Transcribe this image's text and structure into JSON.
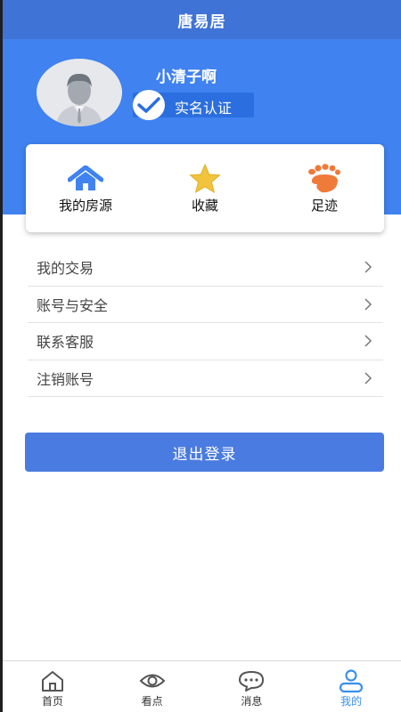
{
  "header": {
    "title": "唐易居"
  },
  "profile": {
    "username": "小清子啊",
    "verify_label": "实名认证"
  },
  "quick_actions": [
    {
      "label": "我的房源",
      "icon": "home-icon",
      "color": "#3f82f0"
    },
    {
      "label": "收藏",
      "icon": "star-icon",
      "color": "#f2c43d"
    },
    {
      "label": "足迹",
      "icon": "footprint-icon",
      "color": "#f07a3a"
    }
  ],
  "menu": [
    {
      "label": "我的交易"
    },
    {
      "label": "账号与安全"
    },
    {
      "label": "联系客服"
    },
    {
      "label": "注销账号"
    }
  ],
  "logout_label": "退出登录",
  "tabbar": [
    {
      "label": "首页",
      "icon": "home-outline-icon"
    },
    {
      "label": "看点",
      "icon": "eye-icon"
    },
    {
      "label": "消息",
      "icon": "chat-bubble-icon"
    },
    {
      "label": "我的",
      "icon": "user-icon",
      "active": true
    }
  ],
  "colors": {
    "primary": "#3f82f0",
    "title_bar": "#3f73d6",
    "active_tab": "#3a8ff0"
  }
}
